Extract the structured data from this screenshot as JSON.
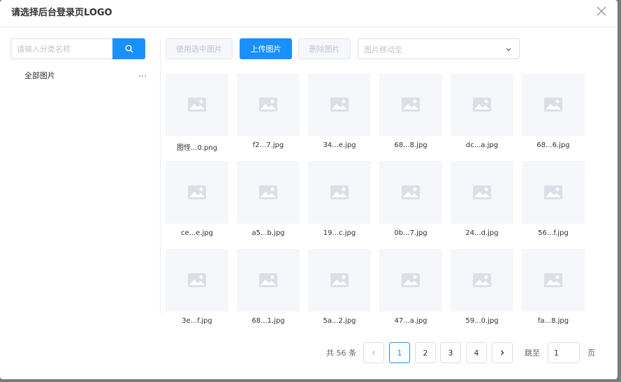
{
  "dialog": {
    "title": "请选择后台登录页LOGO"
  },
  "sidebar": {
    "search_placeholder": "请输入分类名称",
    "categories": [
      {
        "label": "全部图片"
      }
    ],
    "more_icon": "…"
  },
  "toolbar": {
    "use_selected_label": "使用选中图片",
    "upload_label": "上传图片",
    "delete_label": "删除图片",
    "move_placeholder": "图片移动至"
  },
  "images": [
    {
      "name": "图怪...0.png"
    },
    {
      "name": "f2...7.jpg"
    },
    {
      "name": "34...e.jpg"
    },
    {
      "name": "68...8.jpg"
    },
    {
      "name": "dc...a.jpg"
    },
    {
      "name": "68...6.jpg"
    },
    {
      "name": "ce...e.jpg"
    },
    {
      "name": "a5...b.jpg"
    },
    {
      "name": "19...c.jpg"
    },
    {
      "name": "0b...7.jpg"
    },
    {
      "name": "24...d.jpg"
    },
    {
      "name": "56...f.jpg"
    },
    {
      "name": "3e...f.jpg"
    },
    {
      "name": "68...1.jpg"
    },
    {
      "name": "5a...2.jpg"
    },
    {
      "name": "47...a.jpg"
    },
    {
      "name": "59...0.jpg"
    },
    {
      "name": "fa...8.jpg"
    }
  ],
  "pagination": {
    "total_label": "共 56 条",
    "pages": [
      "1",
      "2",
      "3",
      "4"
    ],
    "current_page": "1",
    "goto_label": "跳至",
    "goto_value": "1",
    "page_unit": "页"
  },
  "colors": {
    "primary": "#1890ff",
    "placeholder_bg": "#f5f7fa"
  }
}
